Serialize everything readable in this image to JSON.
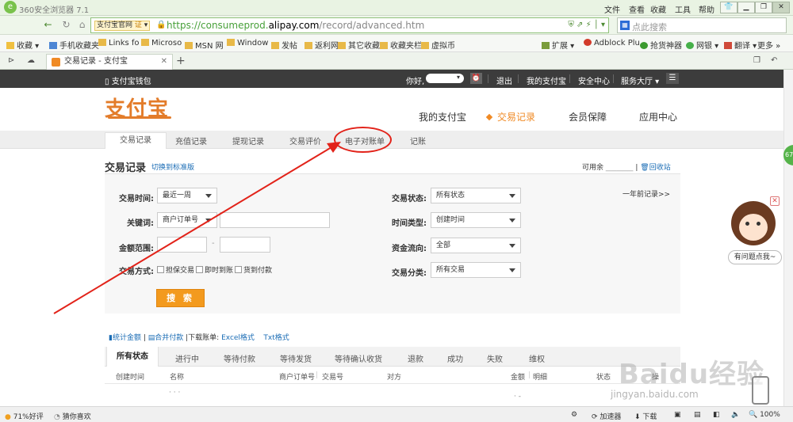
{
  "browser": {
    "app_title": "360安全浏览器 7.1",
    "menu": [
      "文件",
      "查看",
      "收藏",
      "工具",
      "帮助"
    ],
    "site_badge": "支付宝官网",
    "site_badge_cert": "证",
    "url_prefix": "https://consumeprod.",
    "url_domain": "alipay.com",
    "url_path": "/record/advanced.htm",
    "search_placeholder": "点此搜索",
    "bookmarks": [
      "收藏",
      "手机收藏夹",
      "Links fo",
      "Microso",
      "MSN 网",
      "Window",
      "发帖",
      "返利网",
      "其它收藏",
      "收藏夹栏",
      "虚拟币"
    ],
    "toolbar_right": [
      "扩展",
      "Adblock Plu",
      "抢货神器",
      "网银",
      "翻译",
      "更多"
    ],
    "tab_title": "交易记录 - 支付宝"
  },
  "topstrip": {
    "wallet": "支付宝钱包",
    "greeting": "你好,",
    "logout": "退出",
    "my_alipay": "我的支付宝",
    "security": "安全中心",
    "service": "服务大厅"
  },
  "header": {
    "logo": "支付宝",
    "nav": [
      "我的支付宝",
      "交易记录",
      "会员保障",
      "应用中心"
    ]
  },
  "subnav": [
    "交易记录",
    "充值记录",
    "提现记录",
    "交易评价",
    "电子对账单",
    "记账"
  ],
  "page": {
    "title": "交易记录",
    "switch_link": "切换到标准版",
    "available": "可用余",
    "recycle": "回收站",
    "year_ago": "一年前记录>>"
  },
  "form": {
    "time_label": "交易时间:",
    "time_value": "最近一周",
    "keyword_label": "关键词:",
    "keyword_type": "商户订单号",
    "amount_label": "金额范围:",
    "amount_sep": "-",
    "method_label": "交易方式:",
    "method_options": [
      "担保交易",
      "即时到账",
      "货到付款"
    ],
    "status_label": "交易状态:",
    "status_value": "所有状态",
    "timetype_label": "时间类型:",
    "timetype_value": "创建时间",
    "flow_label": "资金流向:",
    "flow_value": "全部",
    "category_label": "交易分类:",
    "category_value": "所有交易",
    "search_button": "搜 索"
  },
  "download": {
    "stats": "统计金额",
    "merge": "合并付款",
    "label": "下载账单:",
    "excel": "Excel格式",
    "txt": "Txt格式"
  },
  "status_tabs": [
    "所有状态",
    "进行中",
    "等待付款",
    "等待发货",
    "等待确认收货",
    "退款",
    "成功",
    "失败",
    "维权"
  ],
  "columns": [
    "创建时间",
    "名称",
    "商户订单号",
    "交易号",
    "对方",
    "金额",
    "明细",
    "状态",
    "操"
  ],
  "side": {
    "help_bubble": "有问题点我~",
    "ring_value": "67"
  },
  "watermark": {
    "main": "Baidu经验",
    "sub": "jingyan.baidu.com"
  },
  "statusbar": {
    "rating": "71%好评",
    "guess": "猜你喜欢",
    "accelerator": "加速器",
    "download": "下载",
    "zoom": "100%"
  }
}
